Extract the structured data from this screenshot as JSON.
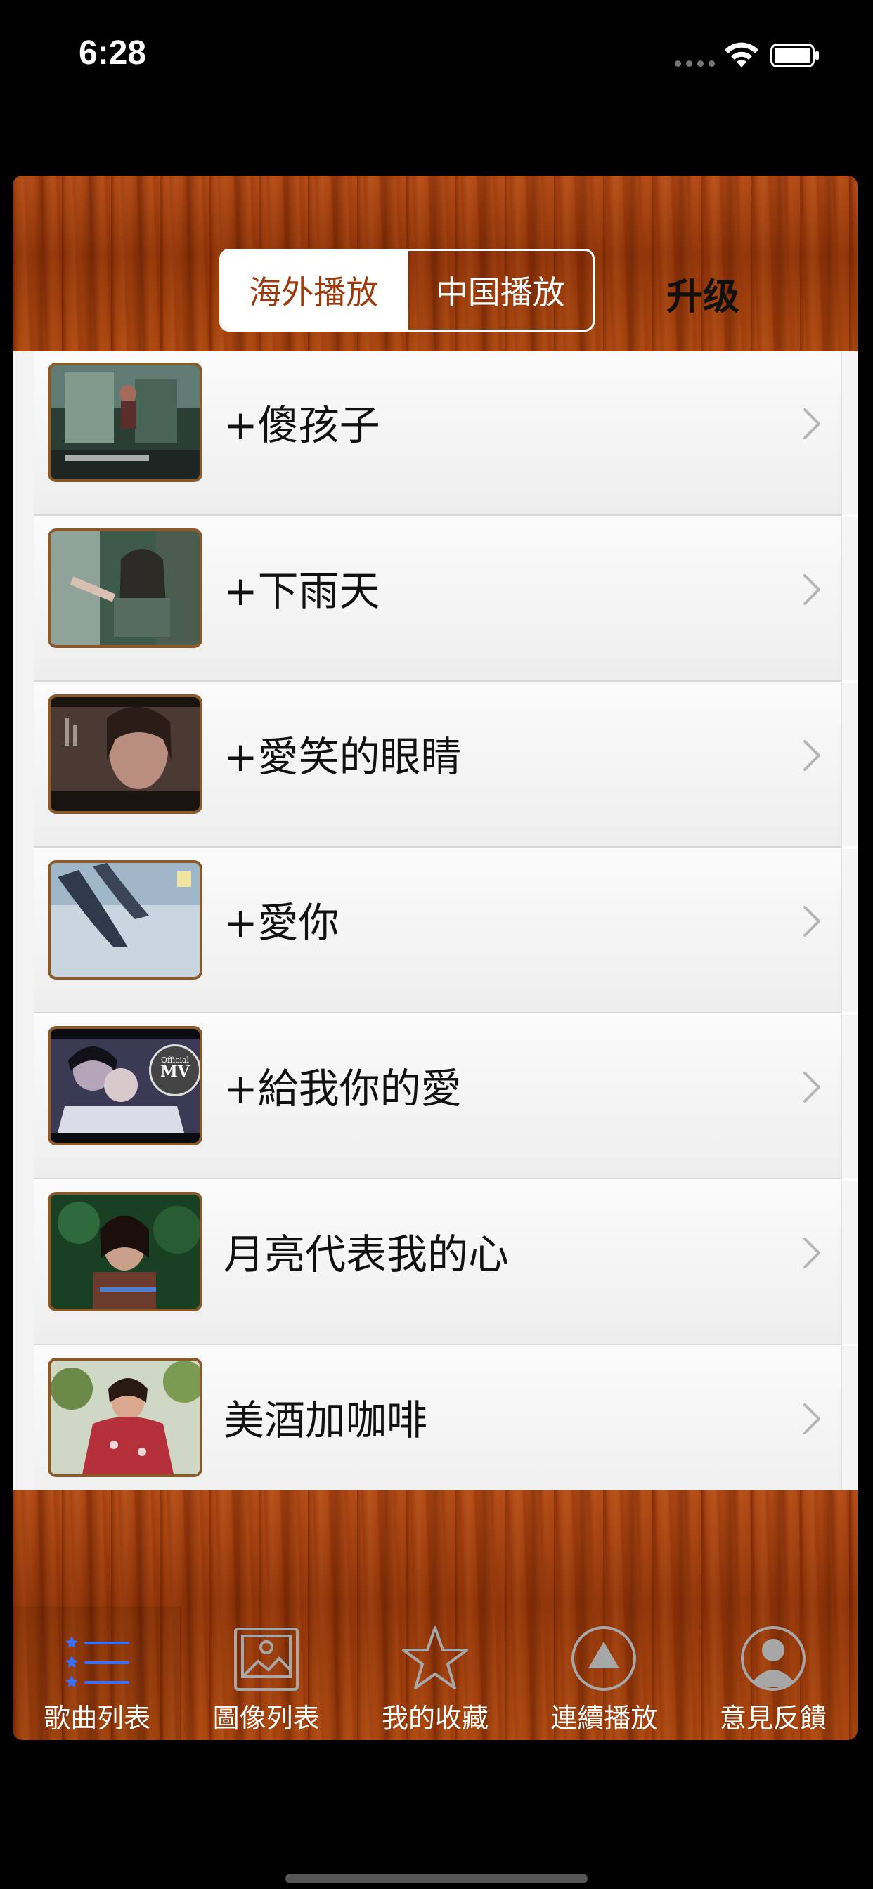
{
  "status_bar": {
    "time": "6:28",
    "icons": [
      "cellular-dots-icon",
      "wifi-icon",
      "battery-icon"
    ]
  },
  "header": {
    "segments": [
      {
        "label": "海外播放",
        "selected": true
      },
      {
        "label": "中国播放",
        "selected": false
      }
    ],
    "upgrade_label": "升级"
  },
  "songs": [
    {
      "title": "+傻孩子",
      "thumbnail": "mv-thumbnail-1"
    },
    {
      "title": "+下雨天",
      "thumbnail": "mv-thumbnail-2"
    },
    {
      "title": "+愛笑的眼睛",
      "thumbnail": "mv-thumbnail-3"
    },
    {
      "title": "+愛你",
      "thumbnail": "mv-thumbnail-4"
    },
    {
      "title": "+給我你的愛",
      "thumbnail": "mv-thumbnail-5",
      "thumb_text": [
        "Official",
        "MV"
      ]
    },
    {
      "title": "月亮代表我的心",
      "thumbnail": "mv-thumbnail-6"
    },
    {
      "title": "美酒加咖啡",
      "thumbnail": "mv-thumbnail-7"
    }
  ],
  "tabs": [
    {
      "label": "歌曲列表",
      "icon": "list-icon",
      "active": true
    },
    {
      "label": "圖像列表",
      "icon": "image-icon",
      "active": false
    },
    {
      "label": "我的收藏",
      "icon": "star-icon",
      "active": false
    },
    {
      "label": "連續播放",
      "icon": "play-circle-icon",
      "active": false
    },
    {
      "label": "意見反饋",
      "icon": "user-circle-icon",
      "active": false
    }
  ],
  "colors": {
    "wood": "#9a3d0f",
    "segment_active_text": "#9b3b0d",
    "tab_active_icon": "#3b6fff",
    "tab_inactive_icon": "#9c9c9c"
  }
}
